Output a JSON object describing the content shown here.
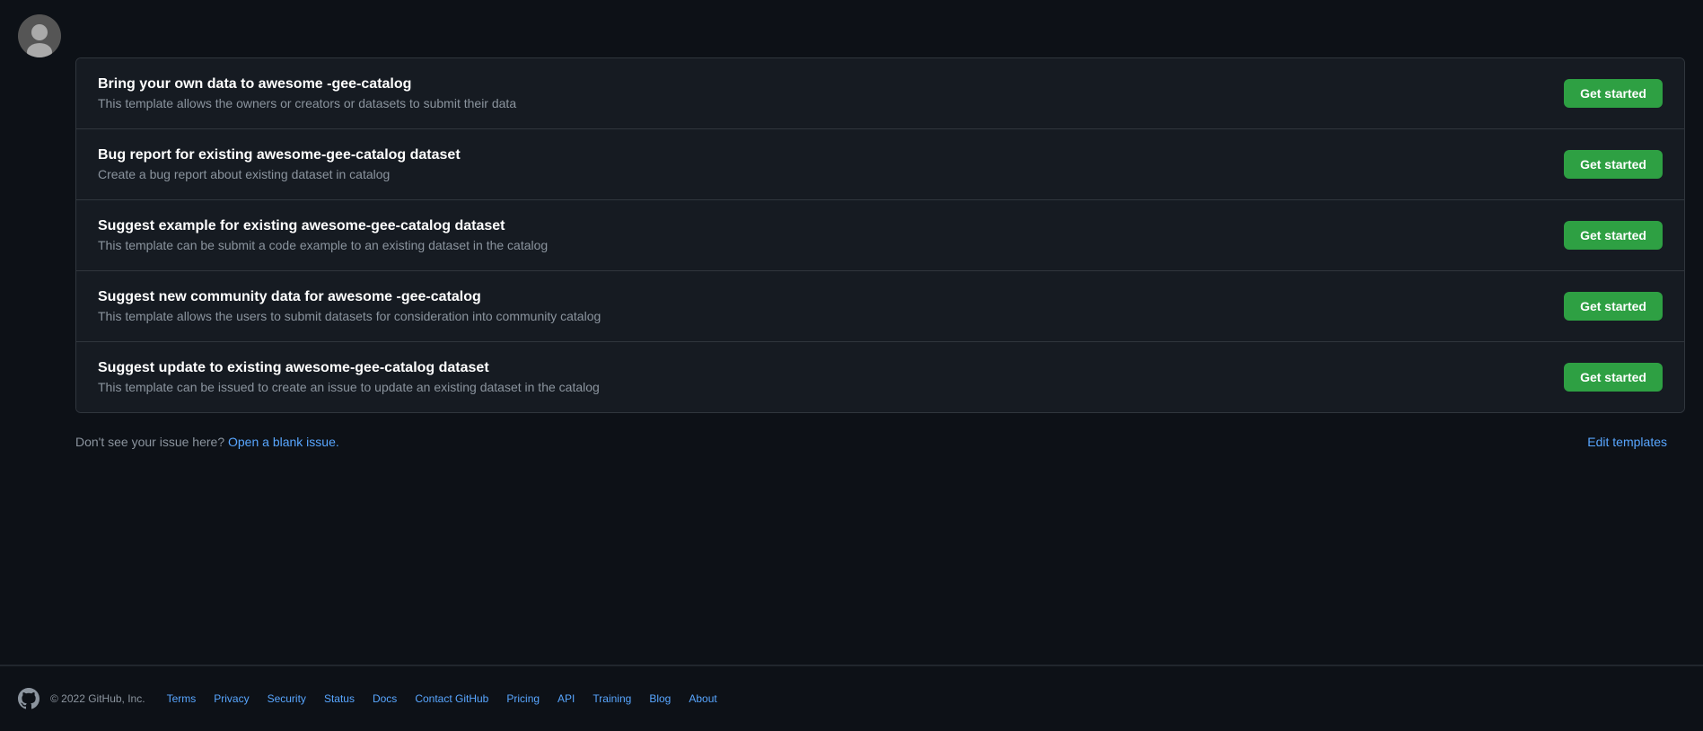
{
  "header": {
    "avatar_alt": "User avatar"
  },
  "templates": [
    {
      "id": "bring-own-data",
      "title": "Bring your own data to awesome -gee-catalog",
      "description": "This template allows the owners or creators or datasets to submit their data",
      "button_label": "Get started"
    },
    {
      "id": "bug-report",
      "title": "Bug report for existing awesome-gee-catalog dataset",
      "description": "Create a bug report about existing dataset in catalog",
      "button_label": "Get started"
    },
    {
      "id": "suggest-example",
      "title": "Suggest example for existing awesome-gee-catalog dataset",
      "description": "This template can be submit a code example to an existing dataset in the catalog",
      "button_label": "Get started"
    },
    {
      "id": "suggest-community",
      "title": "Suggest new community data for awesome -gee-catalog",
      "description": "This template allows the users to submit datasets for consideration into community catalog",
      "button_label": "Get started"
    },
    {
      "id": "suggest-update",
      "title": "Suggest update to existing awesome-gee-catalog dataset",
      "description": "This template can be issued to create an issue to update an existing dataset in the catalog",
      "button_label": "Get started"
    }
  ],
  "blank_issue": {
    "prefix_text": "Don't see your issue here?",
    "link_text": "Open a blank issue.",
    "link_href": "#"
  },
  "edit_templates": {
    "label": "Edit templates",
    "link_href": "#"
  },
  "footer": {
    "copyright": "© 2022 GitHub, Inc.",
    "links": [
      {
        "label": "Terms",
        "href": "#"
      },
      {
        "label": "Privacy",
        "href": "#"
      },
      {
        "label": "Security",
        "href": "#"
      },
      {
        "label": "Status",
        "href": "#"
      },
      {
        "label": "Docs",
        "href": "#"
      },
      {
        "label": "Contact GitHub",
        "href": "#"
      },
      {
        "label": "Pricing",
        "href": "#"
      },
      {
        "label": "API",
        "href": "#"
      },
      {
        "label": "Training",
        "href": "#"
      },
      {
        "label": "Blog",
        "href": "#"
      },
      {
        "label": "About",
        "href": "#"
      }
    ]
  }
}
